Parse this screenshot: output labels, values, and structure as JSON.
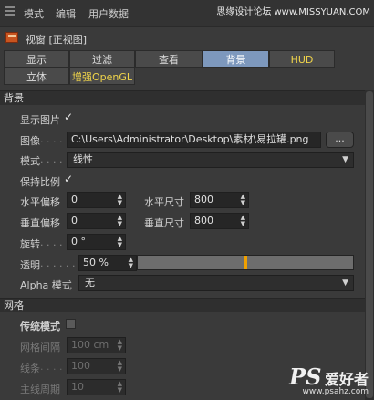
{
  "menu": {
    "items": [
      "模式",
      "编辑",
      "用户数据"
    ],
    "watermark": "思缘设计论坛 www.MISSYUAN.COM"
  },
  "panel": {
    "title": "视窗 [正视图]"
  },
  "tabs": {
    "row1": [
      "显示",
      "过滤",
      "查看",
      "背景",
      "HUD"
    ],
    "row2": [
      "立体",
      "增强OpenGL"
    ],
    "active": "背景"
  },
  "background": {
    "section": "背景",
    "show_image": {
      "label": "显示图片",
      "checked": true
    },
    "image": {
      "label": "图像",
      "dots": ". . . . . .",
      "value": "C:\\Users\\Administrator\\Desktop\\素材\\易拉罐.png",
      "browse": "..."
    },
    "mode": {
      "label": "模式",
      "dots": ". . . . . .",
      "value": "线性"
    },
    "keep_ratio": {
      "label": "保持比例",
      "checked": true
    },
    "h_offset": {
      "label": "水平偏移",
      "value": "0"
    },
    "h_size": {
      "label": "水平尺寸",
      "value": "800"
    },
    "v_offset": {
      "label": "垂直偏移",
      "value": "0"
    },
    "v_size": {
      "label": "垂直尺寸",
      "value": "800"
    },
    "rotation": {
      "label": "旋转",
      "dots": ". . . . . .",
      "value": "0 °"
    },
    "transparency": {
      "label": "透明",
      "dots": ". . . . . .",
      "value": "50 %",
      "level": 0.5
    },
    "alpha_mode": {
      "label": "Alpha 模式",
      "value": "无"
    }
  },
  "grid": {
    "section": "网格",
    "legacy_mode": {
      "label": "传统模式",
      "checked": false
    },
    "spacing": {
      "label": "网格间隔",
      "value": "100 cm"
    },
    "lines": {
      "label": "线条",
      "dots": ". . . . . .",
      "value": "100"
    },
    "major": {
      "label": "主线周期",
      "value": "10"
    }
  },
  "logo": {
    "ps": "PS",
    "text": "爱好者",
    "url": "www.psahz.com"
  },
  "colors": {
    "accent": "#7d98bd",
    "highlight": "#f0a000",
    "tab_text": "#f0d44a"
  }
}
